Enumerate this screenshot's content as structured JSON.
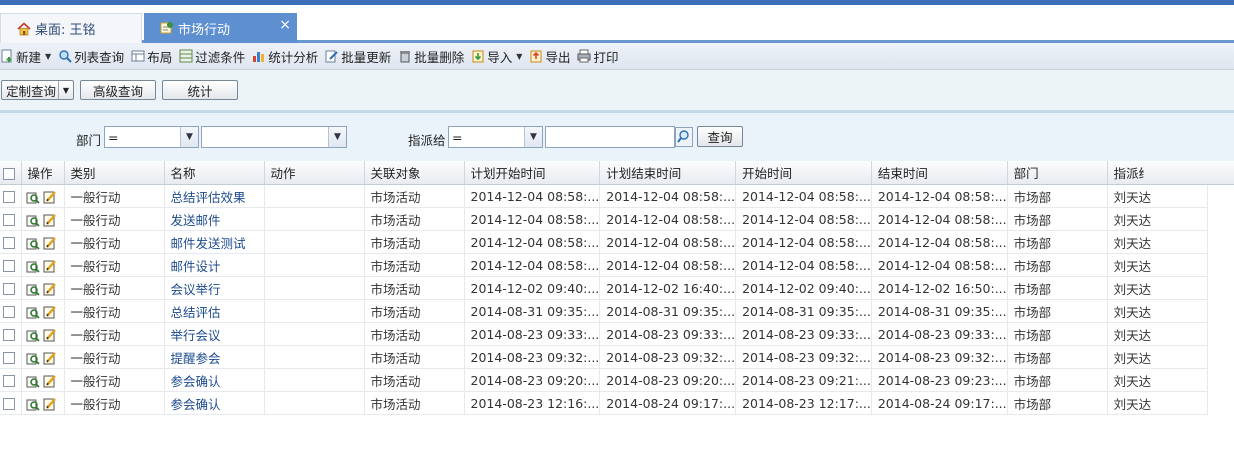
{
  "tabs": [
    {
      "label": "桌面: 王铭",
      "icon": "home-icon",
      "active": false
    },
    {
      "label": "市场行动",
      "icon": "module-icon",
      "active": true,
      "close": "×"
    }
  ],
  "toolbar": {
    "new": "新建",
    "list_query": "列表查询",
    "layout": "布局",
    "filter": "过滤条件",
    "stats_analysis": "统计分析",
    "batch_update": "批量更新",
    "batch_delete": "批量删除",
    "import": "导入",
    "export": "导出",
    "print": "打印"
  },
  "actions": {
    "custom_query": "定制查询",
    "advanced_query": "高级查询",
    "statistics": "统计"
  },
  "filters": {
    "dept_label": "部门",
    "dept_op": "=",
    "dept_value": "",
    "assignee_label": "指派给",
    "assignee_op": "=",
    "assignee_value": "",
    "query_button": "查询"
  },
  "table": {
    "headers": [
      "操作",
      "类别",
      "名称",
      "动作",
      "关联对象",
      "计划开始时间",
      "计划结束时间",
      "开始时间",
      "结束时间",
      "部门",
      "指派给"
    ],
    "rows": [
      {
        "category": "一般行动",
        "name": "总结评估效果",
        "action": "",
        "related": "市场活动",
        "plan_start": "2014-12-04 08:58:...",
        "plan_end": "2014-12-04 08:58:...",
        "start": "2014-12-04 08:58:...",
        "end": "2014-12-04 08:58:...",
        "dept": "市场部",
        "assignee": "刘天达"
      },
      {
        "category": "一般行动",
        "name": "发送邮件",
        "action": "",
        "related": "市场活动",
        "plan_start": "2014-12-04 08:58:...",
        "plan_end": "2014-12-04 08:58:...",
        "start": "2014-12-04 08:58:...",
        "end": "2014-12-04 08:58:...",
        "dept": "市场部",
        "assignee": "刘天达"
      },
      {
        "category": "一般行动",
        "name": "邮件发送测试",
        "action": "",
        "related": "市场活动",
        "plan_start": "2014-12-04 08:58:...",
        "plan_end": "2014-12-04 08:58:...",
        "start": "2014-12-04 08:58:...",
        "end": "2014-12-04 08:58:...",
        "dept": "市场部",
        "assignee": "刘天达"
      },
      {
        "category": "一般行动",
        "name": "邮件设计",
        "action": "",
        "related": "市场活动",
        "plan_start": "2014-12-04 08:58:...",
        "plan_end": "2014-12-04 08:58:...",
        "start": "2014-12-04 08:58:...",
        "end": "2014-12-04 08:58:...",
        "dept": "市场部",
        "assignee": "刘天达"
      },
      {
        "category": "一般行动",
        "name": "会议举行",
        "action": "",
        "related": "市场活动",
        "plan_start": "2014-12-02 09:40:...",
        "plan_end": "2014-12-02 16:40:...",
        "start": "2014-12-02 09:40:...",
        "end": "2014-12-02 16:50:...",
        "dept": "市场部",
        "assignee": "刘天达"
      },
      {
        "category": "一般行动",
        "name": "总结评估",
        "action": "",
        "related": "市场活动",
        "plan_start": "2014-08-31 09:35:...",
        "plan_end": "2014-08-31 09:35:...",
        "start": "2014-08-31 09:35:...",
        "end": "2014-08-31 09:35:...",
        "dept": "市场部",
        "assignee": "刘天达"
      },
      {
        "category": "一般行动",
        "name": "举行会议",
        "action": "",
        "related": "市场活动",
        "plan_start": "2014-08-23 09:33:...",
        "plan_end": "2014-08-23 09:33:...",
        "start": "2014-08-23 09:33:...",
        "end": "2014-08-23 09:33:...",
        "dept": "市场部",
        "assignee": "刘天达"
      },
      {
        "category": "一般行动",
        "name": "提醒参会",
        "action": "",
        "related": "市场活动",
        "plan_start": "2014-08-23 09:32:...",
        "plan_end": "2014-08-23 09:32:...",
        "start": "2014-08-23 09:32:...",
        "end": "2014-08-23 09:32:...",
        "dept": "市场部",
        "assignee": "刘天达"
      },
      {
        "category": "一般行动",
        "name": "参会确认",
        "action": "",
        "related": "市场活动",
        "plan_start": "2014-08-23 09:20:...",
        "plan_end": "2014-08-23 09:20:...",
        "start": "2014-08-23 09:21:...",
        "end": "2014-08-23 09:23:...",
        "dept": "市场部",
        "assignee": "刘天达"
      },
      {
        "category": "一般行动",
        "name": "参会确认",
        "action": "",
        "related": "市场活动",
        "plan_start": "2014-08-23 12:16:...",
        "plan_end": "2014-08-24 09:17:...",
        "start": "2014-08-23 12:17:...",
        "end": "2014-08-24 09:17:...",
        "dept": "市场部",
        "assignee": "刘天达"
      }
    ]
  },
  "colors": {
    "accent": "#3c6fb8",
    "active_tab": "#5e8fd0",
    "link": "#1d4b8f"
  }
}
